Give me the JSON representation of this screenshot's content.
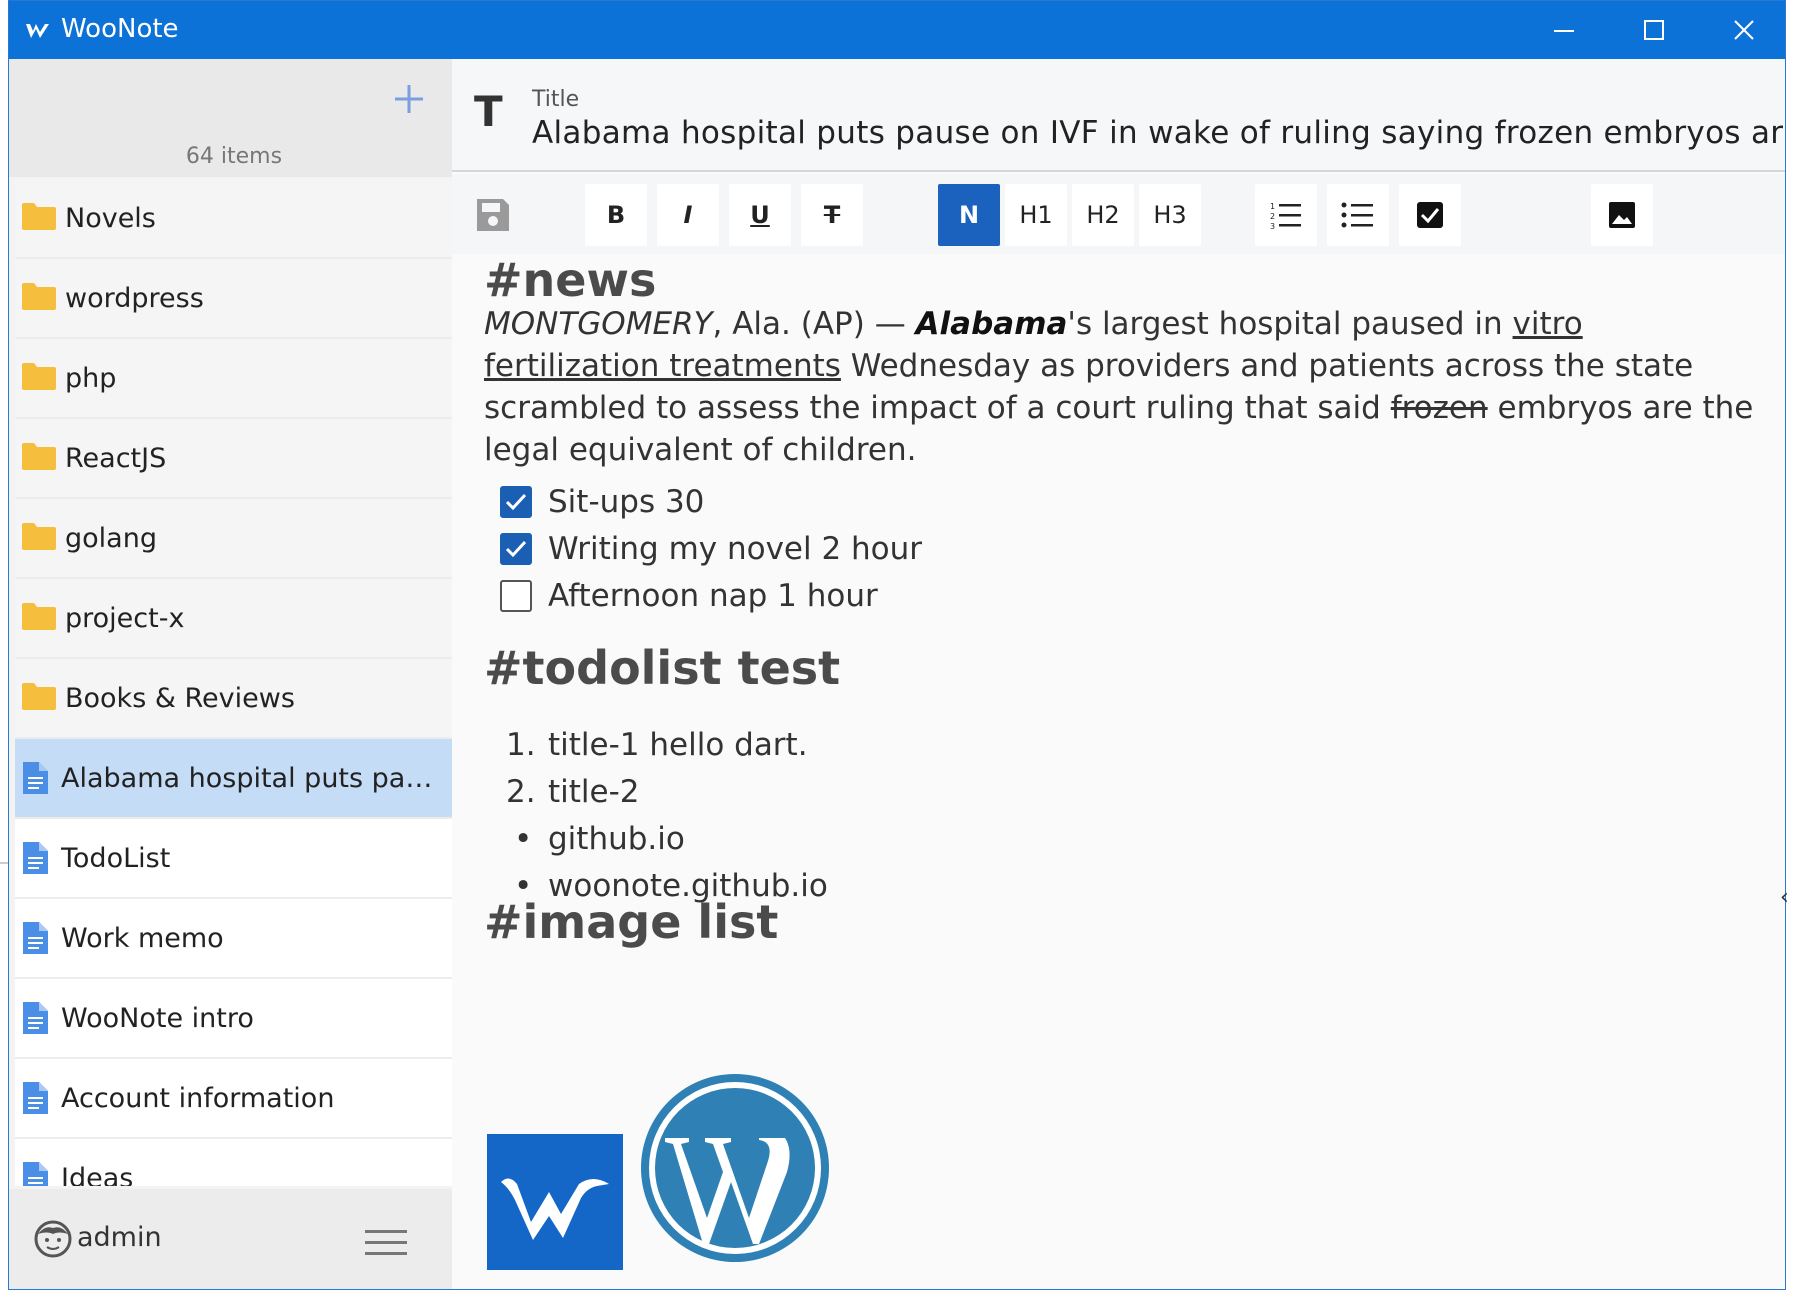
{
  "window": {
    "title": "WooNote"
  },
  "sidebar": {
    "count_label": "64 items",
    "items": [
      {
        "label": "Novels",
        "kind": "folder"
      },
      {
        "label": "wordpress",
        "kind": "folder"
      },
      {
        "label": "php",
        "kind": "folder"
      },
      {
        "label": "ReactJS",
        "kind": "folder"
      },
      {
        "label": "golang",
        "kind": "folder"
      },
      {
        "label": "project-x",
        "kind": "folder"
      },
      {
        "label": "Books & Reviews",
        "kind": "folder"
      },
      {
        "label": "Alabama hospital puts paus...",
        "kind": "note",
        "selected": true
      },
      {
        "label": "TodoList",
        "kind": "note"
      },
      {
        "label": "Work memo",
        "kind": "note"
      },
      {
        "label": "WooNote intro",
        "kind": "note"
      },
      {
        "label": "Account information",
        "kind": "note"
      },
      {
        "label": "Ideas",
        "kind": "note"
      }
    ],
    "user": {
      "name": "admin"
    }
  },
  "note": {
    "title_label": "Title",
    "title_value": "Alabama hospital puts pause on IVF in wake of ruling saying frozen embryos are ch"
  },
  "toolbar": {
    "bold": "B",
    "italic": "I",
    "underline": "U",
    "strike": "T",
    "normal": "N",
    "h1": "H1",
    "h2": "H2",
    "h3": "H3",
    "active_style": "N"
  },
  "content": {
    "h_news": "#news",
    "para": {
      "p1_italic": "MONTGOMERY",
      "p1_rest": ", Ala. (AP) — ",
      "p1_bolditalic": "Alabama",
      "p1_after": "'s largest hospital paused in ",
      "p1_link": "vitro fertilization treatments",
      "p1_mid": " Wednesday as providers and patients across the state scrambled to assess the impact of a court ruling that said ",
      "p1_strike": "frozen",
      "p1_end": " embryos are the legal equivalent of children."
    },
    "checklist": [
      {
        "label": "Sit-ups 30",
        "checked": true
      },
      {
        "label": "Writing my novel 2 hour",
        "checked": true
      },
      {
        "label": "Afternoon nap 1 hour",
        "checked": false
      }
    ],
    "h_todo": "#todolist test",
    "ordered": [
      {
        "num": "1.",
        "text": "title-1 hello dart."
      },
      {
        "num": "2.",
        "text": "title-2"
      }
    ],
    "bullets": [
      "github.io",
      "woonote.github.io"
    ],
    "h_images": "#image list"
  },
  "colors": {
    "titlebar": "#0c72d8",
    "selected_row": "#c5dcf6",
    "active_button": "#1a62bd",
    "folder": "#f6be3d",
    "note_icon": "#4a8ee6"
  },
  "icons": {
    "app": "woonote-logo-icon",
    "add": "plus-icon",
    "folder": "folder-icon",
    "note": "document-icon",
    "user": "user-face-icon",
    "menu": "hamburger-icon",
    "save": "save-icon",
    "image": "image-icon"
  }
}
